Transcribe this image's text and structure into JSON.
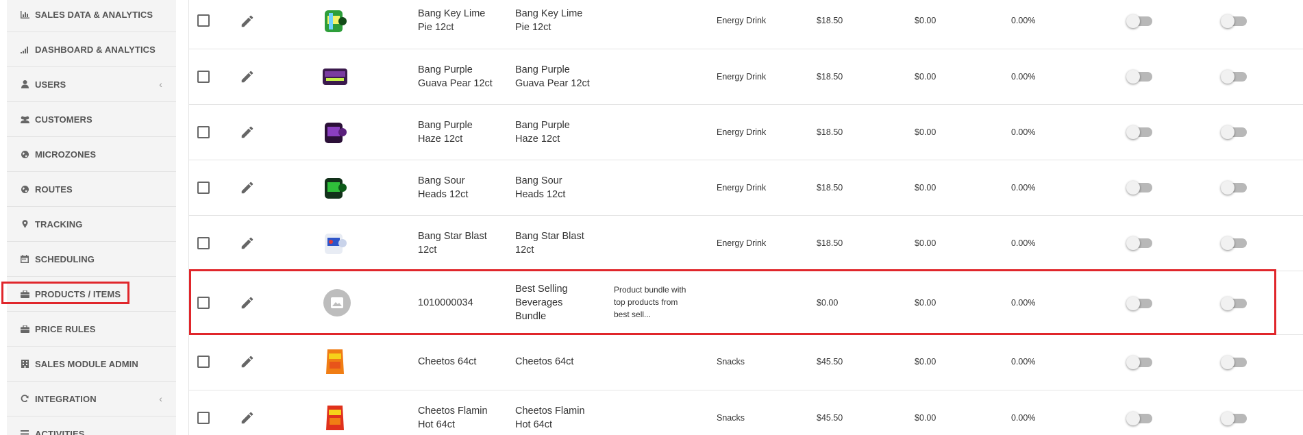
{
  "sidebar": {
    "items": [
      {
        "label": "SALES DATA & ANALYTICS",
        "icon": "bar-chart-icon"
      },
      {
        "label": "DASHBOARD & ANALYTICS",
        "icon": "signal-bars-icon"
      },
      {
        "label": "USERS",
        "icon": "user-icon",
        "chevron": "‹"
      },
      {
        "label": "CUSTOMERS",
        "icon": "users-icon"
      },
      {
        "label": "MICROZONES",
        "icon": "globe-icon"
      },
      {
        "label": "ROUTES",
        "icon": "globe-icon"
      },
      {
        "label": "TRACKING",
        "icon": "map-marker-icon"
      },
      {
        "label": "SCHEDULING",
        "icon": "calendar-icon"
      },
      {
        "label": "PRODUCTS / ITEMS",
        "icon": "briefcase-icon"
      },
      {
        "label": "PRICE RULES",
        "icon": "briefcase-icon"
      },
      {
        "label": "SALES MODULE ADMIN",
        "icon": "building-icon"
      },
      {
        "label": "INTEGRATION",
        "icon": "refresh-icon",
        "chevron": "‹"
      },
      {
        "label": "ACTIVITIES",
        "icon": "list-icon"
      }
    ]
  },
  "products": {
    "rows": [
      {
        "code_line1": "Bang Key Lime",
        "code_line2": "Pie 12ct",
        "name_line1": "Bang Key Lime",
        "name_line2": "Pie 12ct",
        "name_line3": "",
        "description_lines": [
          "",
          "",
          ""
        ],
        "category": "Energy Drink",
        "price": "$18.50",
        "discount": "$0.00",
        "percent": "0.00%",
        "image": "green-can-icon"
      },
      {
        "code_line1": "Bang Purple",
        "code_line2": "Guava Pear 12ct",
        "name_line1": "Bang Purple",
        "name_line2": "Guava Pear 12ct",
        "name_line3": "",
        "description_lines": [
          "",
          "",
          ""
        ],
        "category": "Energy Drink",
        "price": "$18.50",
        "discount": "$0.00",
        "percent": "0.00%",
        "image": "purple-case-icon"
      },
      {
        "code_line1": "Bang Purple",
        "code_line2": "Haze 12ct",
        "name_line1": "Bang Purple",
        "name_line2": "Haze 12ct",
        "name_line3": "",
        "description_lines": [
          "",
          "",
          ""
        ],
        "category": "Energy Drink",
        "price": "$18.50",
        "discount": "$0.00",
        "percent": "0.00%",
        "image": "purple-can-icon"
      },
      {
        "code_line1": "Bang Sour",
        "code_line2": "Heads 12ct",
        "name_line1": "Bang Sour",
        "name_line2": "Heads 12ct",
        "name_line3": "",
        "description_lines": [
          "",
          "",
          ""
        ],
        "category": "Energy Drink",
        "price": "$18.50",
        "discount": "$0.00",
        "percent": "0.00%",
        "image": "green-can-icon"
      },
      {
        "code_line1": "Bang Star Blast",
        "code_line2": "12ct",
        "name_line1": "Bang Star Blast",
        "name_line2": "12ct",
        "name_line3": "",
        "description_lines": [
          "",
          "",
          ""
        ],
        "category": "Energy Drink",
        "price": "$18.50",
        "discount": "$0.00",
        "percent": "0.00%",
        "image": "blue-can-icon"
      },
      {
        "code_line1": "1010000034",
        "code_line2": "",
        "name_line1": "Best Selling",
        "name_line2": "Beverages",
        "name_line3": "Bundle",
        "description_lines": [
          "Product bundle with",
          "top products from",
          "best sell..."
        ],
        "category": "",
        "price": "$0.00",
        "discount": "$0.00",
        "percent": "0.00%",
        "image": "image-placeholder-icon"
      },
      {
        "code_line1": "Cheetos 64ct",
        "code_line2": "",
        "name_line1": "Cheetos 64ct",
        "name_line2": "",
        "name_line3": "",
        "description_lines": [
          "",
          "",
          ""
        ],
        "category": "Snacks",
        "price": "$45.50",
        "discount": "$0.00",
        "percent": "0.00%",
        "image": "orange-bag-icon"
      },
      {
        "code_line1": "Cheetos Flamin",
        "code_line2": "Hot 64ct",
        "name_line1": "Cheetos Flamin",
        "name_line2": "Hot 64ct",
        "name_line3": "",
        "description_lines": [
          "",
          "",
          ""
        ],
        "category": "Snacks",
        "price": "$45.50",
        "discount": "$0.00",
        "percent": "0.00%",
        "image": "red-bag-icon"
      }
    ]
  },
  "colors": {
    "highlight": "#e0262b",
    "sidebar_bg": "#f4f4f4",
    "toggle_track": "#b8b8b8"
  }
}
